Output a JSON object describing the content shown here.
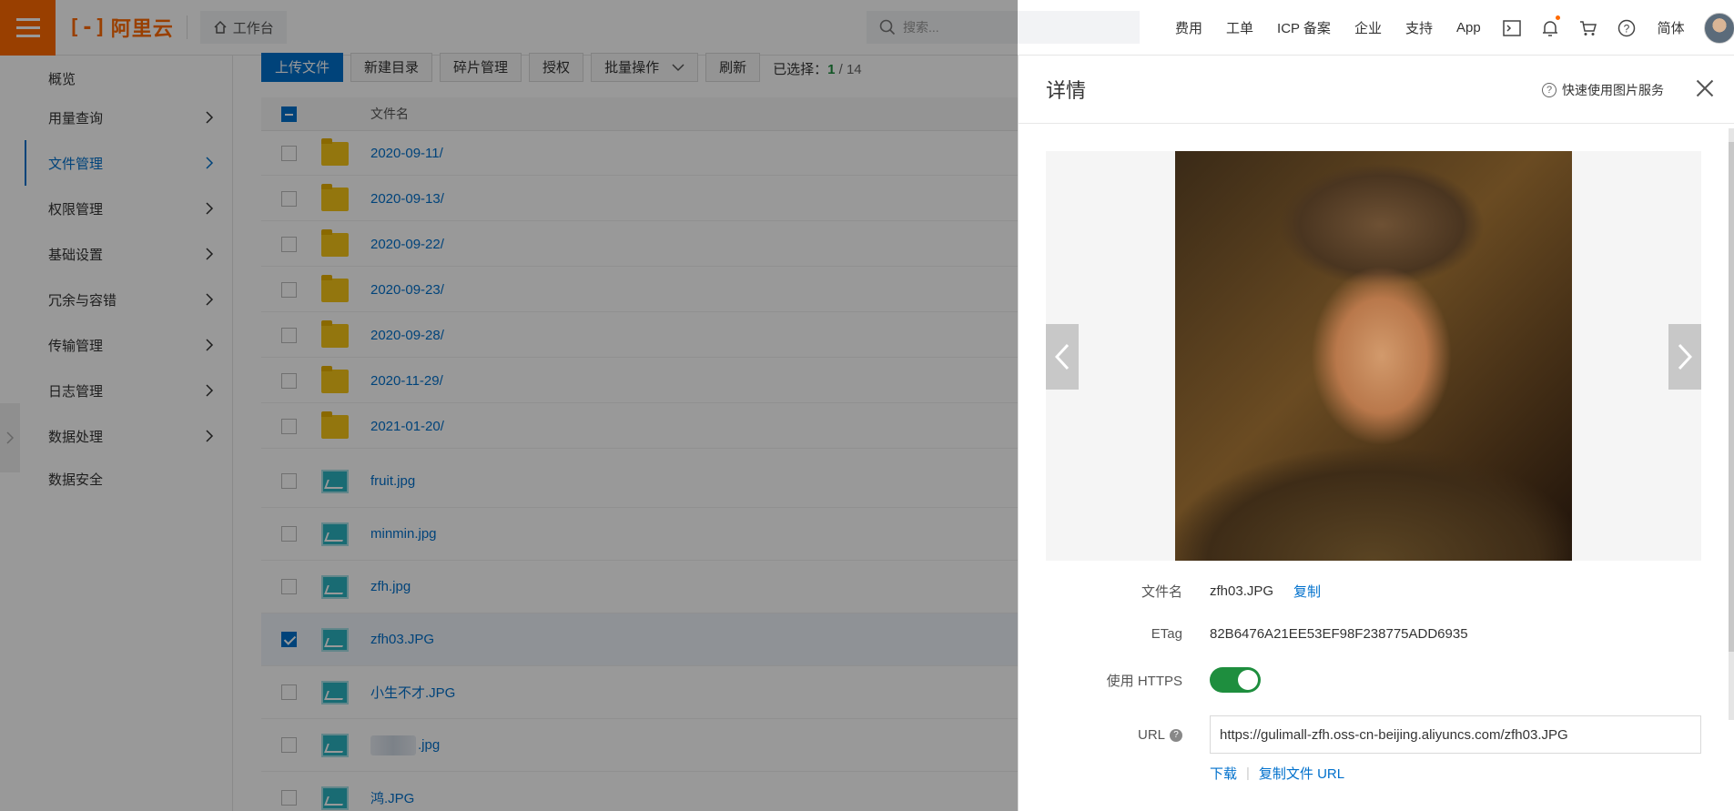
{
  "brand": {
    "name": "阿里云",
    "logo_mark": "[-]",
    "color": "#ff6a00"
  },
  "header": {
    "workbench": "工作台",
    "search_placeholder": "搜索...",
    "nav": [
      "费用",
      "工单",
      "ICP 备案",
      "企业",
      "支持",
      "App"
    ],
    "lang": "简体",
    "icons": [
      "terminal-icon",
      "bell-icon",
      "cart-icon",
      "help-icon"
    ]
  },
  "sidebar": {
    "items": [
      {
        "label": "概览",
        "has_chevron": false,
        "active": false
      },
      {
        "label": "用量查询",
        "has_chevron": true,
        "active": false
      },
      {
        "label": "文件管理",
        "has_chevron": true,
        "active": true
      },
      {
        "label": "权限管理",
        "has_chevron": true,
        "active": false
      },
      {
        "label": "基础设置",
        "has_chevron": true,
        "active": false
      },
      {
        "label": "冗余与容错",
        "has_chevron": true,
        "active": false
      },
      {
        "label": "传输管理",
        "has_chevron": true,
        "active": false
      },
      {
        "label": "日志管理",
        "has_chevron": true,
        "active": false
      },
      {
        "label": "数据处理",
        "has_chevron": true,
        "active": false
      },
      {
        "label": "数据安全",
        "has_chevron": false,
        "active": false
      }
    ]
  },
  "toolbar": {
    "upload": "上传文件",
    "new_dir": "新建目录",
    "fragments": "碎片管理",
    "authorize": "授权",
    "batch": "批量操作",
    "refresh": "刷新",
    "selected_label": "已选择：",
    "selected_count": "1",
    "selected_sep": " / ",
    "total_count": "14"
  },
  "list": {
    "header": "文件名",
    "rows": [
      {
        "name": "2020-09-11/",
        "type": "folder",
        "checked": false
      },
      {
        "name": "2020-09-13/",
        "type": "folder",
        "checked": false
      },
      {
        "name": "2020-09-22/",
        "type": "folder",
        "checked": false
      },
      {
        "name": "2020-09-23/",
        "type": "folder",
        "checked": false
      },
      {
        "name": "2020-09-28/",
        "type": "folder",
        "checked": false
      },
      {
        "name": "2020-11-29/",
        "type": "folder",
        "checked": false
      },
      {
        "name": "2021-01-20/",
        "type": "folder",
        "checked": false
      },
      {
        "name": "fruit.jpg",
        "type": "image",
        "checked": false
      },
      {
        "name": "minmin.jpg",
        "type": "image",
        "checked": false
      },
      {
        "name": "zfh.jpg",
        "type": "image",
        "checked": false
      },
      {
        "name": "zfh03.JPG",
        "type": "image",
        "checked": true
      },
      {
        "name": "小生不才.JPG",
        "type": "image",
        "checked": false
      },
      {
        "name": ".jpg",
        "type": "image",
        "checked": false,
        "blurred_prefix": true
      },
      {
        "name": "鸿.JPG",
        "type": "image",
        "checked": false
      }
    ]
  },
  "detail": {
    "title": "详情",
    "help_link": "快速使用图片服务",
    "filename_label": "文件名",
    "filename": "zfh03.JPG",
    "copy": "复制",
    "etag_label": "ETag",
    "etag": "82B6476A21EE53EF98F238775ADD6935",
    "https_label": "使用 HTTPS",
    "https_on": true,
    "url_label": "URL",
    "url": "https://gulimall-zfh.oss-cn-beijing.aliyuncs.com/zfh03.JPG",
    "download": "下载",
    "copy_url": "复制文件 URL"
  }
}
